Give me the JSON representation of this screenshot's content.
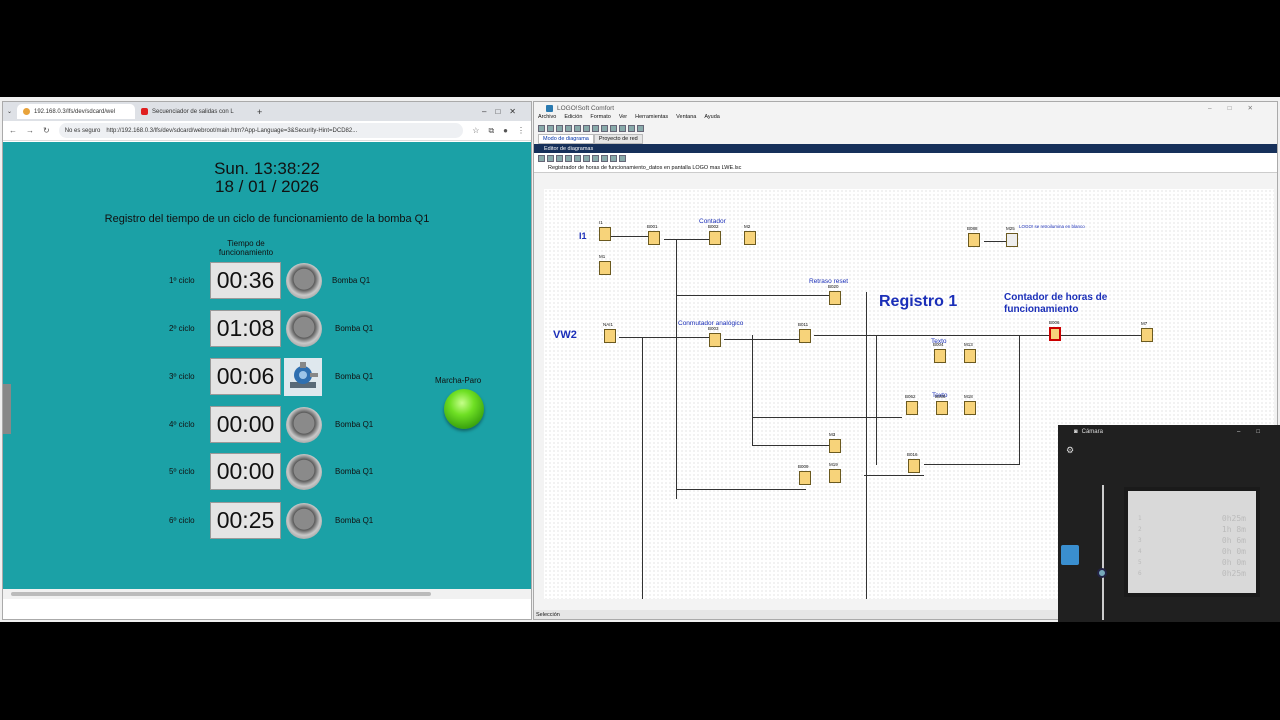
{
  "browser": {
    "tabs": [
      {
        "label": "192.168.0.3/lfs/dev/sdcard/wel"
      },
      {
        "label": "Secuenciador de salidas con L"
      }
    ],
    "new_tab": "+",
    "security_warning": "No es seguro",
    "url": "http://192.168.0.3/lfs/dev/sdcard/webroot/main.htm?App-Language=3&Security-Hint=DCD82..."
  },
  "page": {
    "clock_time": "Sun. 13:38:22",
    "clock_date": "18 / 01 / 2026",
    "title": "Registro del tiempo de un ciclo de funcionamiento de la bomba Q1",
    "column_header": "Tiempo de funcionamiento",
    "rows": [
      {
        "cycle": "1º ciclo",
        "time": "00:36",
        "label": "Bomba Q1"
      },
      {
        "cycle": "2º ciclo",
        "time": "01:08",
        "label": "Bomba Q1"
      },
      {
        "cycle": "3º ciclo",
        "time": "00:06",
        "label": "Bomba Q1"
      },
      {
        "cycle": "4º ciclo",
        "time": "00:00",
        "label": "Bomba Q1"
      },
      {
        "cycle": "5º ciclo",
        "time": "00:00",
        "label": "Bomba Q1"
      },
      {
        "cycle": "6º ciclo",
        "time": "00:25",
        "label": "Bomba Q1"
      }
    ],
    "marcha_label": "Marcha-Paro"
  },
  "logo": {
    "title": "LOGO!Soft Comfort",
    "menu": [
      "Archivo",
      "Edición",
      "Formato",
      "Ver",
      "Herramientas",
      "Ventana",
      "Ayuda"
    ],
    "tabs": [
      "Modo de diagrama",
      "Proyecto de red"
    ],
    "editor_label": "Editor de diagramas",
    "doc_tab": "Registrador de horas de funcionamiento_datos en pantalla LOGO mas LWE.lsc",
    "labels": {
      "contador": "Contador",
      "retraso": "Retraso reset",
      "registro": "Registro 1",
      "contador_horas": "Contador de horas de funcionamiento",
      "conmutador": "Conmutador analógico",
      "texto1": "Texto",
      "texto2": "Texto",
      "i1": "I1",
      "vw2": "VW2",
      "m25_note": "LOGO! se retroilumina en blanco"
    },
    "blocks": [
      "I1",
      "B001",
      "B002",
      "M2",
      "M1",
      "B020",
      "NAI1",
      "B003",
      "B011",
      "B004",
      "M13",
      "B062",
      "B005",
      "M18",
      "M3",
      "B009",
      "M19",
      "B016",
      "B006",
      "M7",
      "B088",
      "M25"
    ],
    "status": "Selección"
  },
  "camera": {
    "title": "Cámara",
    "display_lines": [
      "0h25m",
      "1h 8m",
      "0h 6m",
      "0h 0m",
      "0h 0m",
      "0h25m"
    ],
    "index_lines": [
      "1",
      "2",
      "3",
      "4",
      "5",
      "6"
    ]
  }
}
